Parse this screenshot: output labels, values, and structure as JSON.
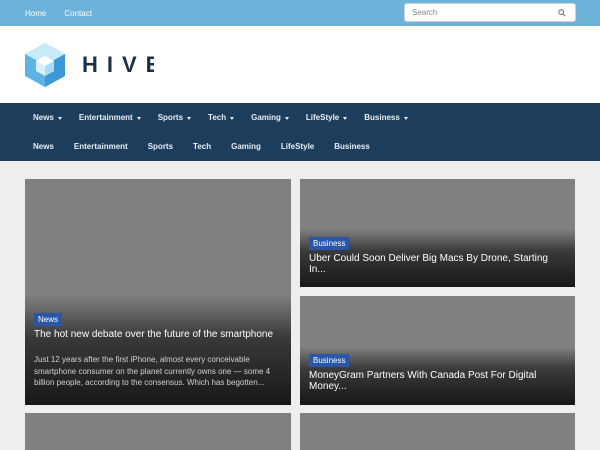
{
  "topbar": {
    "links": [
      "Home",
      "Contact"
    ],
    "search_placeholder": "Search"
  },
  "header": {
    "logo_text": "HIVE"
  },
  "nav": {
    "primary": [
      "News",
      "Entertainment",
      "Sports",
      "Tech",
      "Gaming",
      "LifeStyle",
      "Business"
    ],
    "secondary": [
      "News",
      "Entertainment",
      "Sports",
      "Tech",
      "Gaming",
      "LifeStyle",
      "Business"
    ]
  },
  "featured": {
    "category": "News",
    "title": "The hot new debate over the future of the smartphone",
    "excerpt": "Just 12 years after the first iPhone, almost every conceivable smartphone consumer on the planet currently owns one — some 4 billion people, according to the consensus. Which has begotten..."
  },
  "side_posts": [
    {
      "category": "Business",
      "title": "Uber Could Soon Deliver Big Macs By Drone, Starting In..."
    },
    {
      "category": "Business",
      "title": "MoneyGram Partners With Canada Post For Digital Money..."
    }
  ],
  "colors": {
    "topbar": "#6db2d9",
    "nav": "#1d3d5c",
    "badge": "#2b56a8",
    "placeholder": "#808080"
  }
}
